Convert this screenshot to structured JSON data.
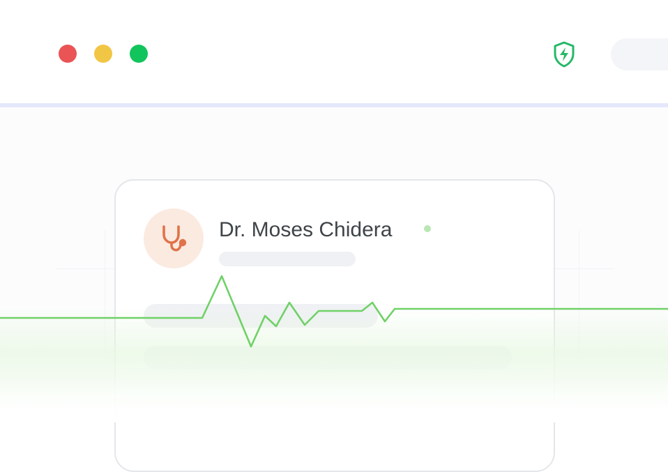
{
  "window": {
    "traffic_lights": [
      {
        "name": "close",
        "color": "#ea5455"
      },
      {
        "name": "minimize",
        "color": "#f1c644"
      },
      {
        "name": "maximize",
        "color": "#12c45c"
      }
    ],
    "security_icon": "shield-lightning-icon",
    "security_color": "#26b868"
  },
  "doctor_card": {
    "name": "Dr. Moses Chidera",
    "status": "online",
    "status_color": "#b9e6b3",
    "avatar_icon": "stethoscope-icon",
    "avatar_color": "#e0734a",
    "avatar_bg": "#fbeae0"
  },
  "ecg": {
    "color": "#6fd166",
    "icon": "heartbeat-line"
  }
}
